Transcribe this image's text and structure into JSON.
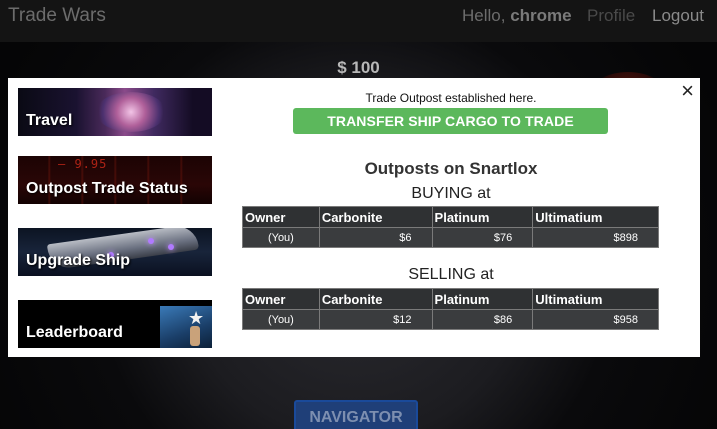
{
  "app": {
    "brand": "Trade Wars"
  },
  "header": {
    "greeting_prefix": "Hello,",
    "username": "chrome",
    "profile_label": "Profile",
    "logout_label": "Logout"
  },
  "page": {
    "money": "$ 100",
    "navigator_label": "NAVIGATOR"
  },
  "modal": {
    "close_label": "×",
    "menu": [
      {
        "label": "Travel"
      },
      {
        "label": "Outpost Trade Status",
        "decor_digits": "— 9.95"
      },
      {
        "label": "Upgrade Ship"
      },
      {
        "label": "Leaderboard"
      }
    ],
    "status_text": "Trade Outpost established here.",
    "transfer_button": "TRANSFER SHIP CARGO TO TRADE OUTPOST",
    "title": "Outposts on Snartlox",
    "buying": {
      "heading": "BUYING at",
      "columns": [
        "Owner",
        "Carbonite",
        "Platinum",
        "Ultimatium"
      ],
      "rows": [
        [
          "(You)",
          "$6",
          "$76",
          "$898"
        ]
      ]
    },
    "selling": {
      "heading": "SELLING at",
      "columns": [
        "Owner",
        "Carbonite",
        "Platinum",
        "Ultimatium"
      ],
      "rows": [
        [
          "(You)",
          "$12",
          "$86",
          "$958"
        ]
      ]
    }
  },
  "colors": {
    "transfer_button": "#5cb85c",
    "table_header": "#2f3133",
    "navigator": "#1f3f78"
  }
}
